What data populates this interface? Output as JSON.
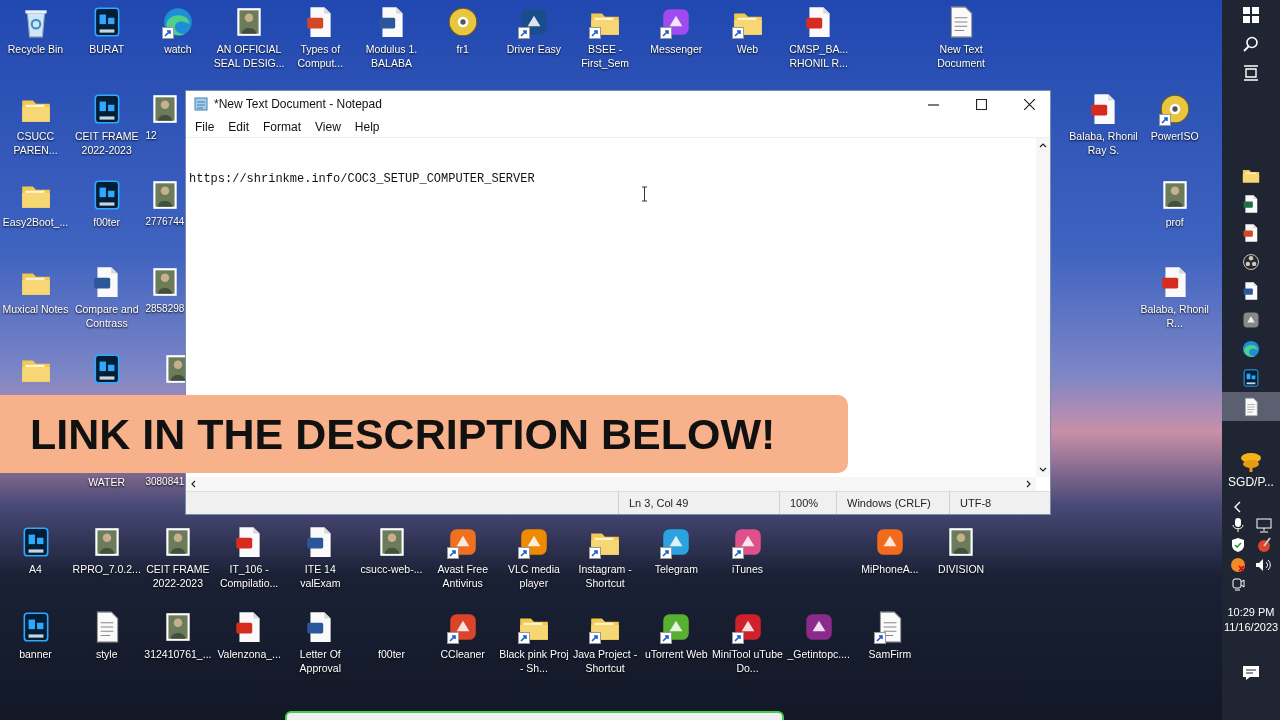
{
  "desktop_icons": [
    {
      "label": "Recycle Bin",
      "kind": "recycle",
      "shortcut": false
    },
    {
      "label": "BURAT",
      "kind": "ps",
      "shortcut": false
    },
    {
      "label": "watch",
      "kind": "edge",
      "shortcut": true
    },
    {
      "label": "AN OFFICIAL SEAL DESIG...",
      "kind": "image",
      "shortcut": false
    },
    {
      "label": "Types of Comput...",
      "kind": "ppt",
      "shortcut": false
    },
    {
      "label": "Modulus 1. BALABA",
      "kind": "word",
      "shortcut": false
    },
    {
      "label": "fr1",
      "kind": "disc",
      "shortcut": false
    },
    {
      "label": "Driver Easy",
      "kind": "app",
      "color": "#1a4d8c",
      "shortcut": true
    },
    {
      "label": "BSEE - First_Sem",
      "kind": "folder",
      "shortcut": true
    },
    {
      "label": "Messenger",
      "kind": "app",
      "color": "#a04bf0",
      "shortcut": true
    },
    {
      "label": "Web",
      "kind": "folder",
      "shortcut": true
    },
    {
      "label": "CMSP_BA... RHONIL R...",
      "kind": "pdf",
      "shortcut": false
    },
    {
      "label": "New Text Document",
      "kind": "text",
      "shortcut": false
    },
    {
      "label": "CSUCC PAREN...",
      "kind": "folder",
      "shortcut": false
    },
    {
      "label": "CEIT FRAME 2022-2023",
      "kind": "ps",
      "shortcut": false
    },
    {
      "label": "12",
      "kind": "image",
      "shortcut": false
    },
    {
      "label": "Balaba, Rhonil Ray S.",
      "kind": "pdf",
      "shortcut": false
    },
    {
      "label": "PowerISO",
      "kind": "disc",
      "shortcut": true
    },
    {
      "label": "Easy2Boot_...",
      "kind": "folder",
      "shortcut": false
    },
    {
      "label": "f00ter",
      "kind": "ps",
      "shortcut": false
    },
    {
      "label": "2776744",
      "kind": "image",
      "shortcut": false
    },
    {
      "label": "prof",
      "kind": "image",
      "shortcut": false
    },
    {
      "label": "Muxical Notes",
      "kind": "folder",
      "shortcut": false
    },
    {
      "label": "Compare and Contrass",
      "kind": "word",
      "shortcut": false
    },
    {
      "label": "2858298",
      "kind": "image",
      "shortcut": false
    },
    {
      "label": "Balaba, Rhonil R...",
      "kind": "pdf",
      "shortcut": false
    },
    {
      "kind": "folder",
      "shortcut": false
    },
    {
      "kind": "ps",
      "shortcut": false
    },
    {
      "kind": "image",
      "shortcut": false
    },
    {
      "label": "WATER",
      "kind": "hidden"
    },
    {
      "label": "3080841",
      "kind": "hidden"
    },
    {
      "label": "A4",
      "kind": "ps",
      "shortcut": false
    },
    {
      "label": "RPRO_7.0.2...",
      "kind": "image",
      "shortcut": false
    },
    {
      "label": "CEIT FRAME 2022-2023",
      "kind": "image",
      "shortcut": false
    },
    {
      "label": "IT_106 - Compilatio...",
      "kind": "pdf",
      "shortcut": false
    },
    {
      "label": "ITE 14 valExam",
      "kind": "word",
      "shortcut": false
    },
    {
      "label": "csucc-web-...",
      "kind": "image",
      "shortcut": false
    },
    {
      "label": "Avast Free Antivirus",
      "kind": "app",
      "color": "#f07020",
      "shortcut": true
    },
    {
      "label": "VLC media player",
      "kind": "app",
      "color": "#f08a00",
      "shortcut": true
    },
    {
      "label": "Instagram - Shortcut",
      "kind": "folder",
      "shortcut": true
    },
    {
      "label": "Telegram",
      "kind": "app",
      "color": "#2aa3e0",
      "shortcut": true
    },
    {
      "label": "iTunes",
      "kind": "app",
      "color": "#e0508a",
      "shortcut": true
    },
    {
      "label": "MiPhoneA...",
      "kind": "app",
      "color": "#f26b1d",
      "shortcut": false
    },
    {
      "label": "DIVISION",
      "kind": "image",
      "shortcut": false
    },
    {
      "label": "banner",
      "kind": "ps",
      "shortcut": false
    },
    {
      "label": "style",
      "kind": "text",
      "shortcut": false
    },
    {
      "label": "312410761_...",
      "kind": "image",
      "shortcut": false
    },
    {
      "label": "Valenzona_...",
      "kind": "pdf",
      "shortcut": false
    },
    {
      "label": "Letter Of Approval",
      "kind": "word",
      "shortcut": false
    },
    {
      "label": "f00ter",
      "kind": "hidden"
    },
    {
      "label": "CCleaner",
      "kind": "app",
      "color": "#d9442a",
      "shortcut": true
    },
    {
      "label": "Black pink Proj - Sh...",
      "kind": "folder",
      "shortcut": true
    },
    {
      "label": "Java Project - Shortcut",
      "kind": "folder",
      "shortcut": true
    },
    {
      "label": "uTorrent Web",
      "kind": "app",
      "color": "#58b030",
      "shortcut": true
    },
    {
      "label": "MiniTool uTube Do...",
      "kind": "app",
      "color": "#d0202a",
      "shortcut": true
    },
    {
      "label": "_Getintopc....",
      "kind": "app",
      "color": "#8a2a8a",
      "shortcut": false
    },
    {
      "label": "SamFirm",
      "kind": "text",
      "shortcut": true
    }
  ],
  "notepad": {
    "title": "*New Text Document - Notepad",
    "menu": [
      "File",
      "Edit",
      "Format",
      "View",
      "Help"
    ],
    "content": "https://shrinkme.info/COC3_SETUP_COMPUTER_SERVER",
    "status_bar": [
      "Ln 3, Col 49",
      "100%",
      "Windows (CRLF)",
      "UTF-8"
    ]
  },
  "banner": {
    "text": "LINK IN THE DESCRIPTION BELOW!"
  },
  "taskbar": {
    "pinned": [
      {
        "kind": "folder",
        "selected": false
      },
      {
        "kind": "excel",
        "selected": false
      },
      {
        "kind": "ppt",
        "selected": false
      },
      {
        "kind": "obs",
        "selected": false
      },
      {
        "kind": "word",
        "selected": false
      },
      {
        "kind": "app",
        "selected": false
      },
      {
        "kind": "edge",
        "selected": false
      },
      {
        "kind": "ps",
        "selected": false
      },
      {
        "kind": "text",
        "selected": true
      }
    ],
    "weather": "SGD/P...",
    "time": "10:29 PM",
    "date": "11/16/2023"
  }
}
